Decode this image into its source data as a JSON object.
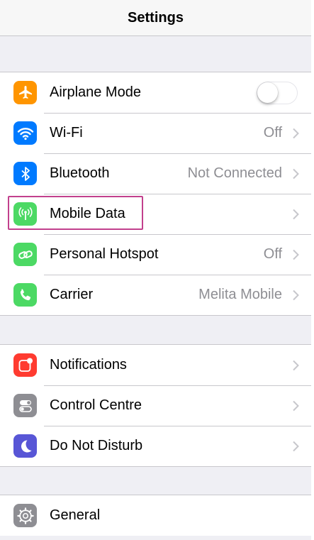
{
  "header": {
    "title": "Settings"
  },
  "group1": [
    {
      "label": "Airplane Mode",
      "value": "",
      "icon": "airplane-icon",
      "color": "#ff9500",
      "control": "toggle",
      "toggle_on": false
    },
    {
      "label": "Wi-Fi",
      "value": "Off",
      "icon": "wifi-icon",
      "color": "#007aff",
      "control": "chevron"
    },
    {
      "label": "Bluetooth",
      "value": "Not Connected",
      "icon": "bluetooth-icon",
      "color": "#007aff",
      "control": "chevron"
    },
    {
      "label": "Mobile Data",
      "value": "",
      "icon": "antenna-icon",
      "color": "#4cd964",
      "control": "chevron"
    },
    {
      "label": "Personal Hotspot",
      "value": "Off",
      "icon": "hotspot-icon",
      "color": "#4cd964",
      "control": "chevron"
    },
    {
      "label": "Carrier",
      "value": "Melita Mobile",
      "icon": "phone-icon",
      "color": "#4cd964",
      "control": "chevron"
    }
  ],
  "group2": [
    {
      "label": "Notifications",
      "value": "",
      "icon": "notifications-icon",
      "color": "#ff3b30",
      "control": "chevron"
    },
    {
      "label": "Control Centre",
      "value": "",
      "icon": "control-centre-icon",
      "color": "#8e8e93",
      "control": "chevron"
    },
    {
      "label": "Do Not Disturb",
      "value": "",
      "icon": "moon-icon",
      "color": "#5856d6",
      "control": "chevron"
    }
  ],
  "group3": [
    {
      "label": "General",
      "value": "",
      "icon": "gear-icon",
      "color": "#8e8e93",
      "control": "none"
    }
  ],
  "highlight_color": "#c2408d"
}
